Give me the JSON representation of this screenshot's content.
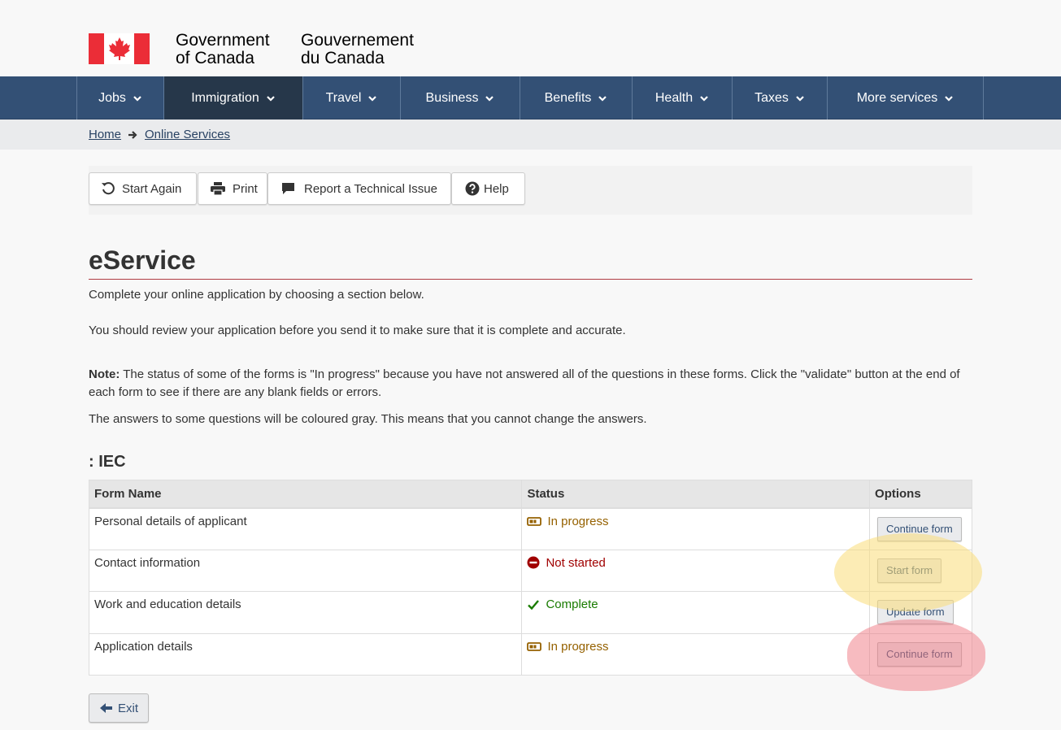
{
  "header": {
    "signature_en_line1": "Government",
    "signature_en_line2": "of Canada",
    "signature_fr_line1": "Gouvernement",
    "signature_fr_line2": "du Canada"
  },
  "nav": {
    "items": [
      {
        "label": "Jobs"
      },
      {
        "label": "Immigration"
      },
      {
        "label": "Travel"
      },
      {
        "label": "Business"
      },
      {
        "label": "Benefits"
      },
      {
        "label": "Health"
      },
      {
        "label": "Taxes"
      },
      {
        "label": "More services"
      }
    ],
    "active": "Immigration"
  },
  "breadcrumb": {
    "home": "Home",
    "current": "Online Services"
  },
  "toolbar": {
    "start_again": "Start Again",
    "print": "Print",
    "report": "Report a Technical Issue",
    "help": "Help"
  },
  "page": {
    "title": "eService",
    "intro": "Complete your online application by choosing a section below.",
    "review": "You should review your application before you send it to make sure that it is complete and accurate.",
    "note_label": "Note:",
    "note_text": " The status of some of the forms is \"In progress\" because you have not answered all of the questions in these forms. Click the \"validate\" button at the end of each form to see if there are any blank fields or errors.",
    "gray_text": "The answers to some questions will be coloured gray. This means that you cannot change the answers.",
    "section_heading": ": IEC"
  },
  "table": {
    "headers": [
      "Form Name",
      "Status",
      "Options"
    ],
    "rows": [
      {
        "name": "Personal details of applicant",
        "status": "In progress",
        "option": "Continue form"
      },
      {
        "name": "Contact information",
        "status": "Not started",
        "option": "Start form"
      },
      {
        "name": "Work and education details",
        "status": "Complete",
        "option": "Update form"
      },
      {
        "name": "Application details",
        "status": "In progress",
        "option": "Continue form"
      }
    ]
  },
  "exit": {
    "label": "Exit"
  },
  "colors": {
    "nav_bg": "#335075",
    "nav_active": "#26374a",
    "flag_red": "#eb2d37",
    "in_progress": "#956100",
    "not_started": "#a00000",
    "complete": "#197b00"
  }
}
